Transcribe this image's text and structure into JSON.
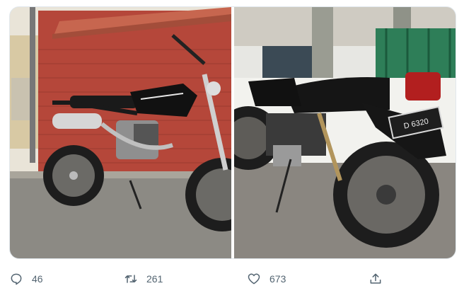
{
  "tweet": {
    "media": [
      {
        "name": "photo-left"
      },
      {
        "name": "photo-right"
      }
    ],
    "plate_text": "D 6320",
    "actions": {
      "reply_count": "46",
      "retweet_count": "261",
      "like_count": "673"
    }
  },
  "colors": {
    "icon": "#536471",
    "brick": "#b5473a",
    "road": "#8c8a84",
    "bike_black": "#1a1a1a"
  },
  "icons": [
    "reply-icon",
    "retweet-icon",
    "like-icon",
    "share-icon"
  ]
}
